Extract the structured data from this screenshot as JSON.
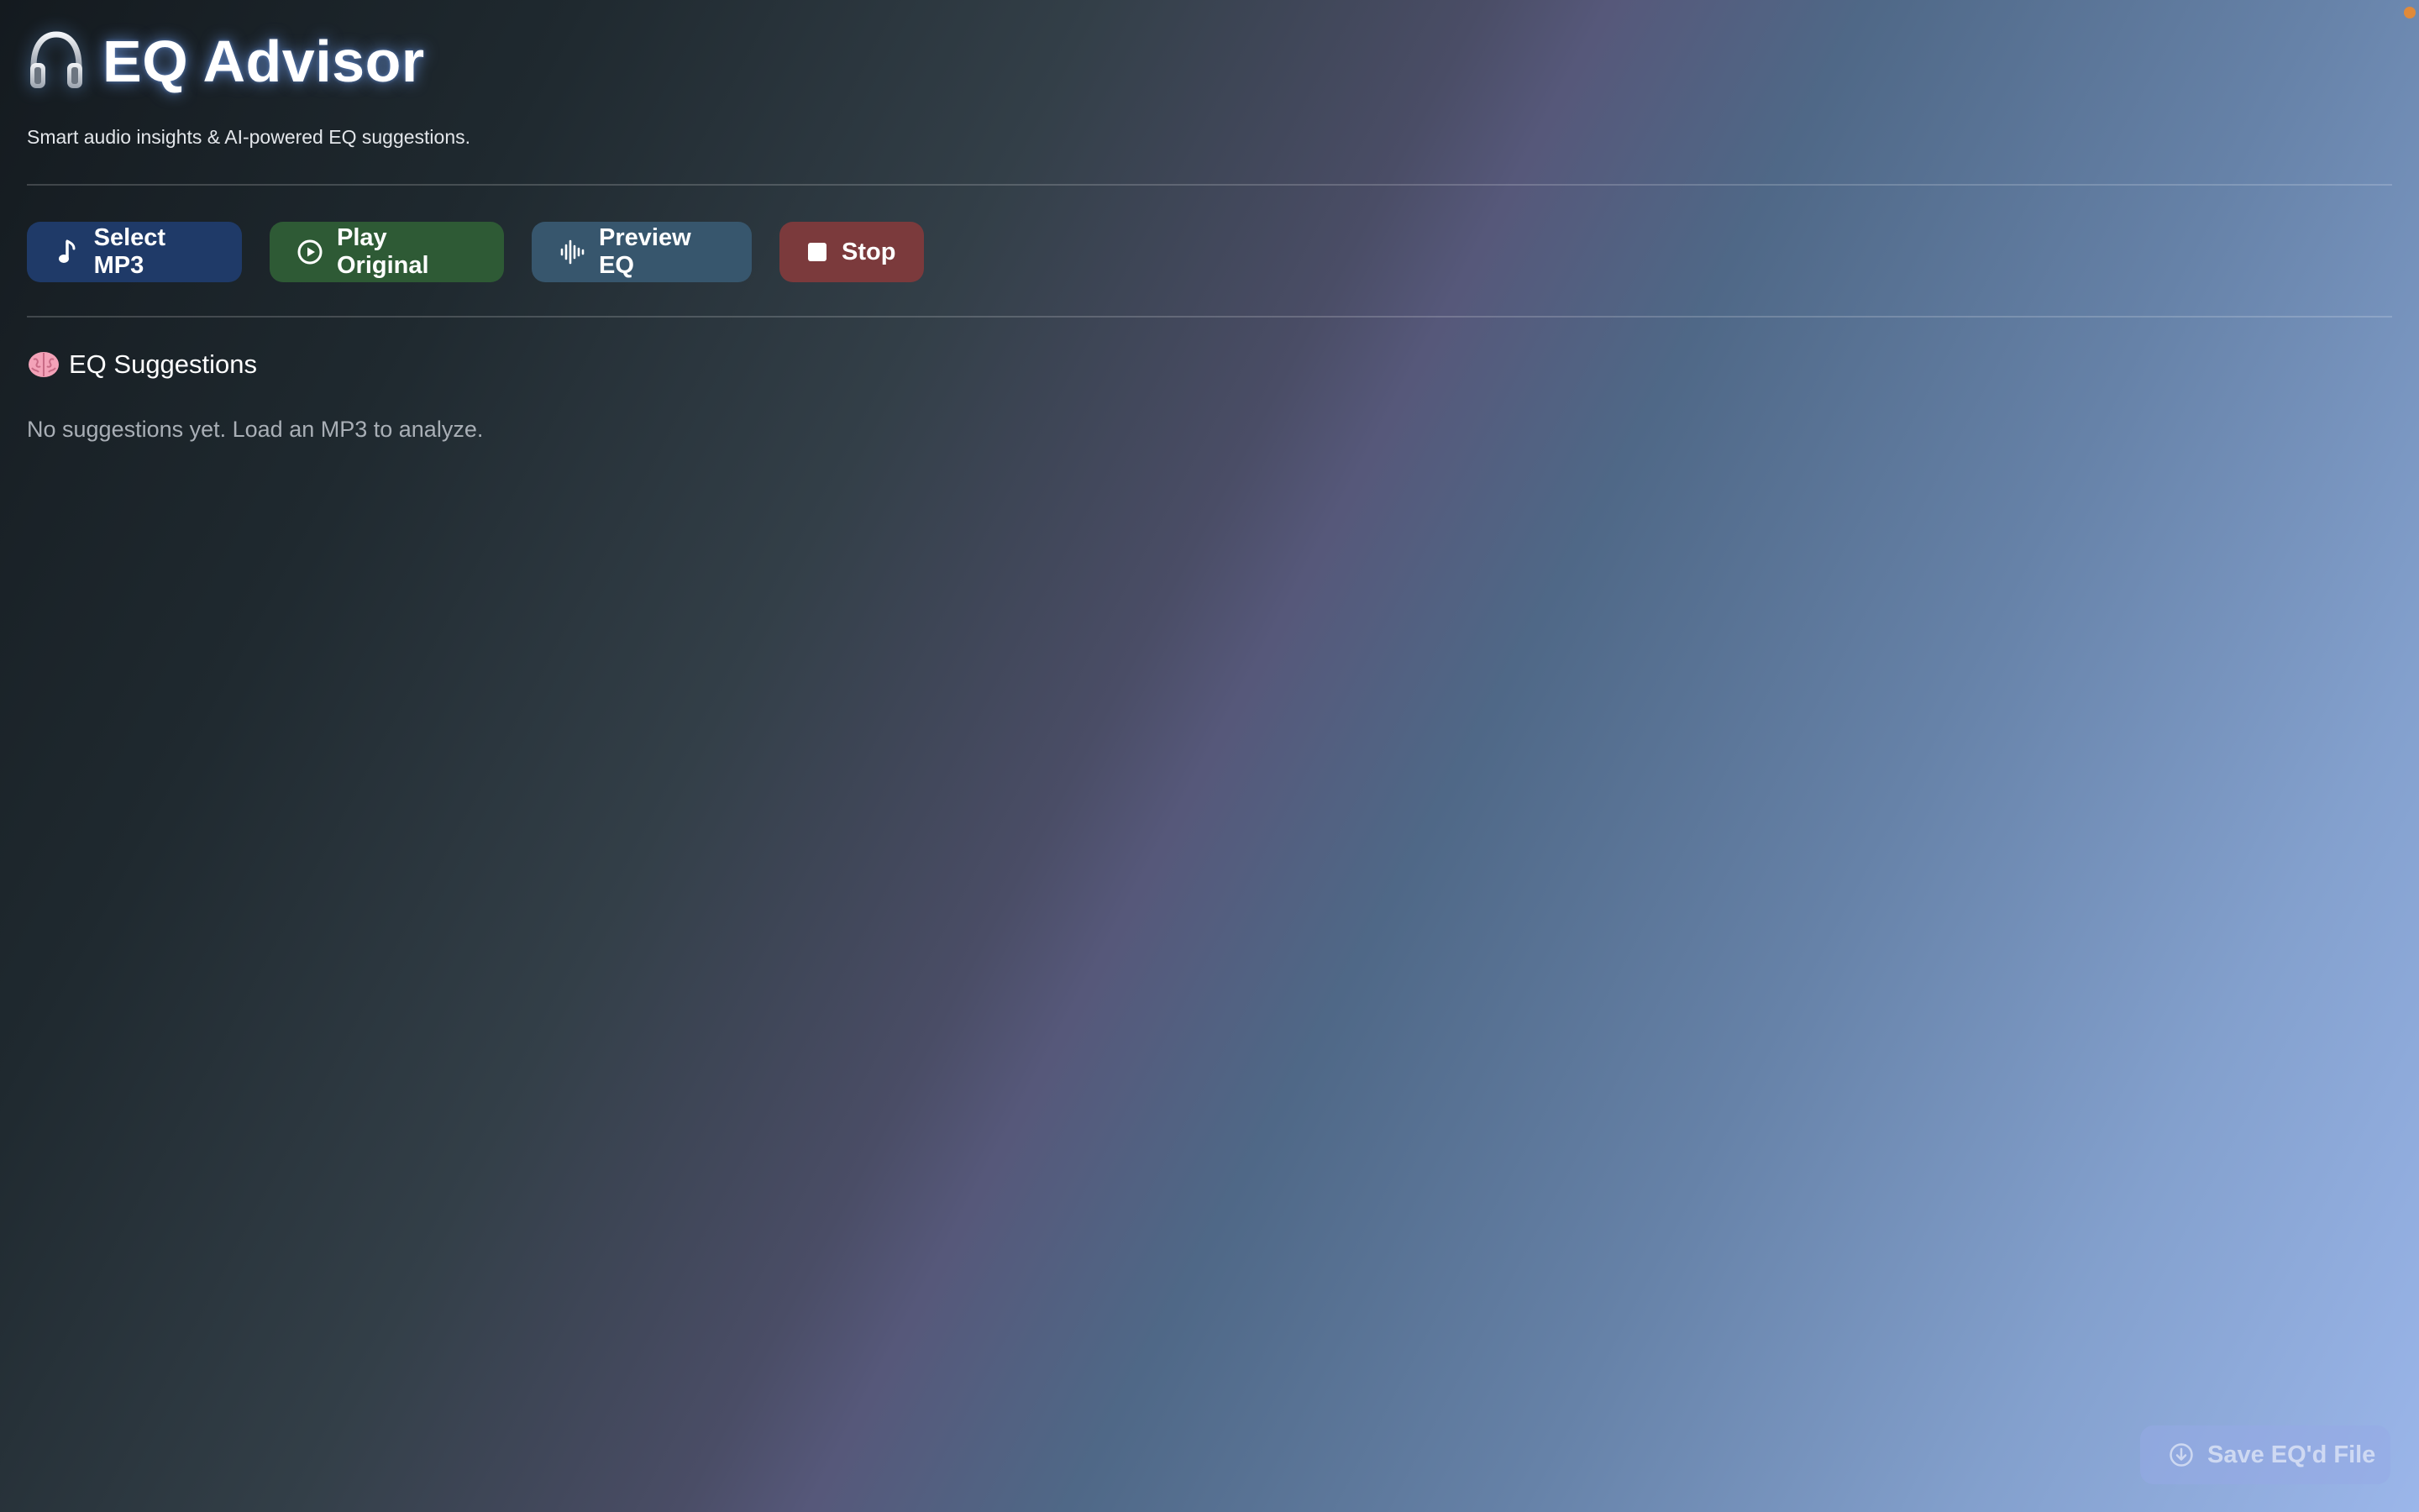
{
  "app": {
    "title": "EQ Advisor",
    "subtitle": "Smart audio insights & AI-powered EQ suggestions.",
    "title_icon": "headphones-icon"
  },
  "toolbar": {
    "select_label": "Select MP3",
    "select_icon": "music-note-icon",
    "play_label": "Play Original",
    "play_icon": "play-circle-icon",
    "preview_label": "Preview EQ",
    "preview_icon": "waveform-icon",
    "stop_label": "Stop",
    "stop_icon": "stop-square-icon"
  },
  "suggestions": {
    "title": "EQ Suggestions",
    "title_icon": "brain-icon",
    "empty_message": "No suggestions yet. Load an MP3 to analyze."
  },
  "footer": {
    "save_label": "Save EQ'd File",
    "save_icon": "download-circle-icon",
    "save_enabled": false
  },
  "colors": {
    "select_button": "#1f3a68",
    "play_button": "#2e5a35",
    "preview_button": "#37566d",
    "stop_button": "#7b3a3c",
    "title_glow": "#78aaff",
    "status_dot": "#e08a3a"
  }
}
